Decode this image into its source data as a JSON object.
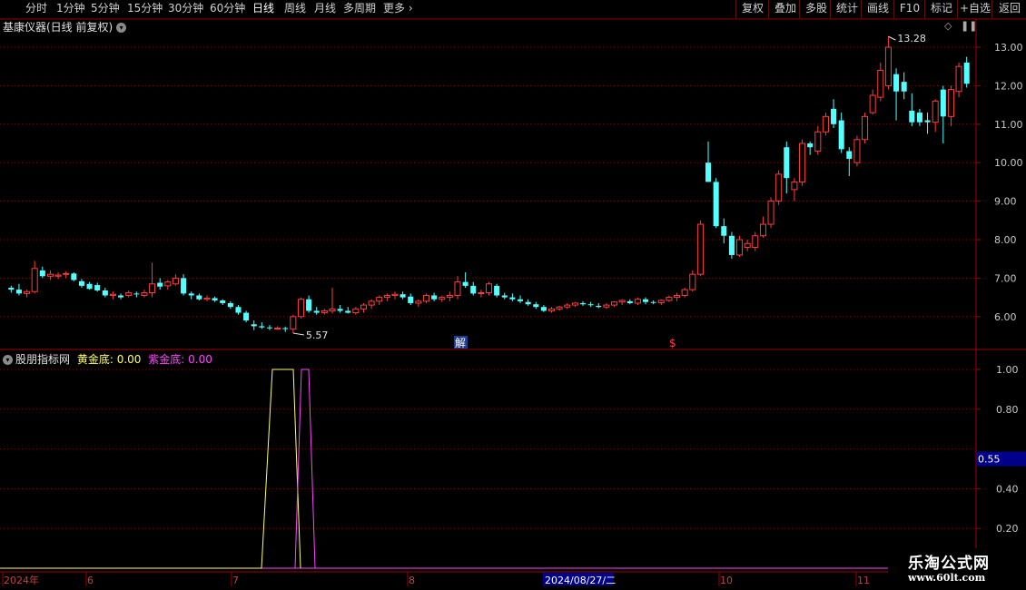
{
  "toolbar": {
    "periods": [
      "分时",
      "1分钟",
      "5分钟",
      "15分钟",
      "30分钟",
      "60分钟",
      "日线",
      "周线",
      "月线",
      "多周期",
      "更多 ›"
    ],
    "active_period": "日线",
    "buttons": [
      "复权",
      "叠加",
      "多股",
      "统计",
      "画线",
      "F10",
      "标记",
      "+自选",
      "返回"
    ]
  },
  "main_chart": {
    "title": "基康仪器(日线 前复权)",
    "price_axis": [
      "13.00",
      "12.00",
      "11.00",
      "10.00",
      "9.00",
      "8.00",
      "7.00",
      "6.00"
    ],
    "high_label": "13.28",
    "low_label": "5.57",
    "marker_jie": "解",
    "marker_s": "$",
    "colors": {
      "up": "#ff3c3c",
      "down": "#54ffff",
      "grid": "#7a0000"
    },
    "candles": [
      [
        6.75,
        6.8,
        6.62,
        6.7
      ],
      [
        6.7,
        6.85,
        6.55,
        6.6
      ],
      [
        6.6,
        6.7,
        6.5,
        6.65
      ],
      [
        6.65,
        7.45,
        6.6,
        7.25
      ],
      [
        7.2,
        7.3,
        7.0,
        7.05
      ],
      [
        7.05,
        7.2,
        6.95,
        7.1
      ],
      [
        7.05,
        7.15,
        6.98,
        7.08
      ],
      [
        7.1,
        7.18,
        7.0,
        7.12
      ],
      [
        7.12,
        7.15,
        6.92,
        6.95
      ],
      [
        6.92,
        6.98,
        6.75,
        6.8
      ],
      [
        6.85,
        6.9,
        6.7,
        6.72
      ],
      [
        6.82,
        6.88,
        6.65,
        6.68
      ],
      [
        6.68,
        6.75,
        6.5,
        6.55
      ],
      [
        6.55,
        6.65,
        6.45,
        6.58
      ],
      [
        6.55,
        6.6,
        6.45,
        6.5
      ],
      [
        6.55,
        6.68,
        6.5,
        6.62
      ],
      [
        6.6,
        6.65,
        6.5,
        6.58
      ],
      [
        6.55,
        6.7,
        6.5,
        6.62
      ],
      [
        6.62,
        7.4,
        6.5,
        6.85
      ],
      [
        6.88,
        7.0,
        6.7,
        6.78
      ],
      [
        6.8,
        6.95,
        6.7,
        6.9
      ],
      [
        6.85,
        7.1,
        6.8,
        7.0
      ],
      [
        7.0,
        7.1,
        6.55,
        6.6
      ],
      [
        6.6,
        6.65,
        6.45,
        6.55
      ],
      [
        6.55,
        6.6,
        6.42,
        6.45
      ],
      [
        6.45,
        6.55,
        6.4,
        6.48
      ],
      [
        6.48,
        6.52,
        6.38,
        6.42
      ],
      [
        6.42,
        6.45,
        6.3,
        6.35
      ],
      [
        6.35,
        6.4,
        6.2,
        6.25
      ],
      [
        6.25,
        6.3,
        6.05,
        6.1
      ],
      [
        6.1,
        6.15,
        5.85,
        5.9
      ],
      [
        5.8,
        5.9,
        5.65,
        5.75
      ],
      [
        5.75,
        5.85,
        5.68,
        5.72
      ],
      [
        5.72,
        5.78,
        5.65,
        5.7
      ],
      [
        5.7,
        5.75,
        5.66,
        5.7
      ],
      [
        5.7,
        5.74,
        5.6,
        5.68
      ],
      [
        5.68,
        6.05,
        5.57,
        6.0
      ],
      [
        6.0,
        6.5,
        5.95,
        6.45
      ],
      [
        6.45,
        6.55,
        6.1,
        6.15
      ],
      [
        6.15,
        6.25,
        6.05,
        6.1
      ],
      [
        6.1,
        6.2,
        6.05,
        6.15
      ],
      [
        6.15,
        6.75,
        6.08,
        6.2
      ],
      [
        6.2,
        6.3,
        6.1,
        6.15
      ],
      [
        6.15,
        6.25,
        6.08,
        6.1
      ],
      [
        6.1,
        6.25,
        6.05,
        6.2
      ],
      [
        6.2,
        6.35,
        6.1,
        6.3
      ],
      [
        6.3,
        6.45,
        6.2,
        6.4
      ],
      [
        6.4,
        6.55,
        6.3,
        6.5
      ],
      [
        6.5,
        6.6,
        6.4,
        6.55
      ],
      [
        6.55,
        6.65,
        6.45,
        6.58
      ],
      [
        6.58,
        6.65,
        6.45,
        6.5
      ],
      [
        6.52,
        6.6,
        6.3,
        6.35
      ],
      [
        6.35,
        6.45,
        6.25,
        6.4
      ],
      [
        6.4,
        6.6,
        6.35,
        6.55
      ],
      [
        6.55,
        6.62,
        6.4,
        6.45
      ],
      [
        6.45,
        6.55,
        6.38,
        6.5
      ],
      [
        6.5,
        6.65,
        6.4,
        6.55
      ],
      [
        6.55,
        7.05,
        6.45,
        6.9
      ],
      [
        6.9,
        7.15,
        6.75,
        6.8
      ],
      [
        6.8,
        6.9,
        6.55,
        6.6
      ],
      [
        6.6,
        6.7,
        6.5,
        6.62
      ],
      [
        6.62,
        6.9,
        6.55,
        6.85
      ],
      [
        6.8,
        6.85,
        6.5,
        6.55
      ],
      [
        6.55,
        6.62,
        6.45,
        6.5
      ],
      [
        6.5,
        6.6,
        6.4,
        6.45
      ],
      [
        6.45,
        6.55,
        6.35,
        6.4
      ],
      [
        6.38,
        6.45,
        6.28,
        6.32
      ],
      [
        6.32,
        6.38,
        6.2,
        6.25
      ],
      [
        6.25,
        6.3,
        6.12,
        6.15
      ],
      [
        6.15,
        6.25,
        6.1,
        6.2
      ],
      [
        6.2,
        6.28,
        6.15,
        6.25
      ],
      [
        6.25,
        6.35,
        6.2,
        6.3
      ],
      [
        6.3,
        6.38,
        6.25,
        6.35
      ],
      [
        6.35,
        6.4,
        6.28,
        6.32
      ],
      [
        6.32,
        6.38,
        6.25,
        6.3
      ],
      [
        6.28,
        6.35,
        6.22,
        6.25
      ],
      [
        6.25,
        6.35,
        6.2,
        6.3
      ],
      [
        6.3,
        6.4,
        6.25,
        6.38
      ],
      [
        6.38,
        6.45,
        6.3,
        6.42
      ],
      [
        6.4,
        6.45,
        6.32,
        6.35
      ],
      [
        6.35,
        6.5,
        6.3,
        6.45
      ],
      [
        6.45,
        6.5,
        6.32,
        6.38
      ],
      [
        6.38,
        6.42,
        6.32,
        6.36
      ],
      [
        6.36,
        6.45,
        6.3,
        6.42
      ],
      [
        6.42,
        6.55,
        6.38,
        6.5
      ],
      [
        6.5,
        6.62,
        6.4,
        6.55
      ],
      [
        6.55,
        6.75,
        6.5,
        6.7
      ],
      [
        6.7,
        7.2,
        6.65,
        7.1
      ],
      [
        7.1,
        8.5,
        7.05,
        8.4
      ],
      [
        10.0,
        10.55,
        9.5,
        9.5
      ],
      [
        9.5,
        9.6,
        8.3,
        8.35
      ],
      [
        8.35,
        8.55,
        7.9,
        8.1
      ],
      [
        8.1,
        8.2,
        7.5,
        7.6
      ],
      [
        7.6,
        8.1,
        7.55,
        8.0
      ],
      [
        7.8,
        8.0,
        7.7,
        7.9
      ],
      [
        7.8,
        8.2,
        7.7,
        8.1
      ],
      [
        8.1,
        8.6,
        8.05,
        8.4
      ],
      [
        8.4,
        9.1,
        8.3,
        9.0
      ],
      [
        9.0,
        9.8,
        8.9,
        9.7
      ],
      [
        10.4,
        10.55,
        9.2,
        9.6
      ],
      [
        9.3,
        9.6,
        9.0,
        9.5
      ],
      [
        9.5,
        10.6,
        9.4,
        10.5
      ],
      [
        10.5,
        10.55,
        10.2,
        10.4
      ],
      [
        10.3,
        10.95,
        10.2,
        10.8
      ],
      [
        10.8,
        11.3,
        10.7,
        11.2
      ],
      [
        11.4,
        11.65,
        10.9,
        11.0
      ],
      [
        11.1,
        11.3,
        10.25,
        10.35
      ],
      [
        10.3,
        10.4,
        9.65,
        10.1
      ],
      [
        10.0,
        10.7,
        9.9,
        10.6
      ],
      [
        10.6,
        11.3,
        10.5,
        11.2
      ],
      [
        11.3,
        11.9,
        11.25,
        11.75
      ],
      [
        11.7,
        12.6,
        11.6,
        12.4
      ],
      [
        12.0,
        13.28,
        11.9,
        13.0
      ],
      [
        12.3,
        12.45,
        11.1,
        11.85
      ],
      [
        12.1,
        12.35,
        11.65,
        11.85
      ],
      [
        11.35,
        11.8,
        10.95,
        11.05
      ],
      [
        11.3,
        11.4,
        10.95,
        11.05
      ],
      [
        11.1,
        11.3,
        10.75,
        11.05
      ],
      [
        11.05,
        11.65,
        10.8,
        11.6
      ],
      [
        11.9,
        12.0,
        10.5,
        11.2
      ],
      [
        11.2,
        12.0,
        10.95,
        11.9
      ],
      [
        11.85,
        12.6,
        11.7,
        12.5
      ],
      [
        12.6,
        12.75,
        11.95,
        12.05
      ]
    ]
  },
  "indicator": {
    "name": "股朋指标网",
    "yellow_label": "黄金底:",
    "yellow_value": "0.00",
    "purple_label": "紫金底:",
    "purple_value": "0.00",
    "axis": [
      "1.00",
      "0.80",
      "0.40",
      "0.20"
    ],
    "current_value": "0.55",
    "colors": {
      "yellow": "#ffff66",
      "purple": "#ff44ff"
    }
  },
  "date_axis": {
    "labels": [
      "2024年",
      "6",
      "7",
      "8",
      "2024/08/27/二",
      "10",
      "11"
    ],
    "highlighted": "2024/08/27/二"
  },
  "watermark": {
    "title": "乐淘公式网",
    "url": "www.60lt.com"
  }
}
